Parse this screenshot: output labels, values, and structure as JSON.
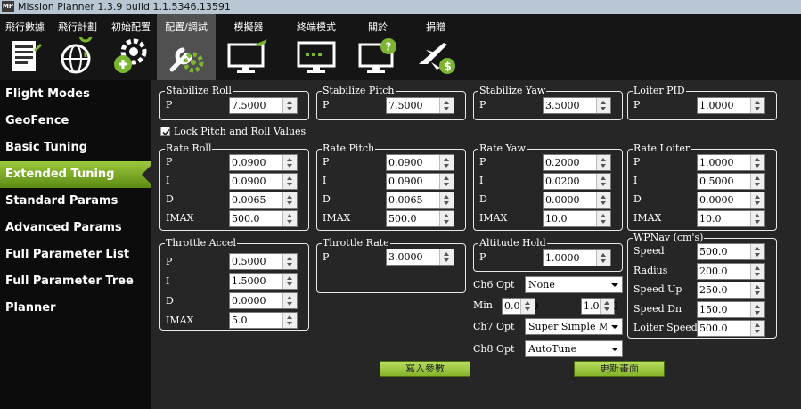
{
  "window": {
    "title": "Mission Planner 1.3.9 build 1.1.5346.13591",
    "icon_text": "MP"
  },
  "menu": [
    {
      "label": "飛行數據",
      "icon": "flight-data-icon"
    },
    {
      "label": "飛行計劃",
      "icon": "globe-icon"
    },
    {
      "label": "初始配置",
      "icon": "gear-plus-icon"
    },
    {
      "label": "配置/調試",
      "icon": "wrench-gear-icon"
    },
    {
      "label": "模擬器",
      "icon": "monitor-plane-icon"
    },
    {
      "label": "終端模式",
      "icon": "terminal-icon"
    },
    {
      "label": "關於",
      "icon": "help-monitor-icon"
    },
    {
      "label": "捐贈",
      "icon": "plane-donate-icon"
    }
  ],
  "sidebar": [
    "Flight Modes",
    "GeoFence",
    "Basic Tuning",
    "Extended Tuning",
    "Standard Params",
    "Advanced Params",
    "Full Parameter List",
    "Full Parameter Tree",
    "Planner"
  ],
  "stabilize_roll": {
    "title": "Stabilize Roll",
    "p_label": "P",
    "p": "7.5000"
  },
  "stabilize_pitch": {
    "title": "Stabilize Pitch",
    "p_label": "P",
    "p": "7.5000"
  },
  "stabilize_yaw": {
    "title": "Stabilize Yaw",
    "p_label": "P",
    "p": "3.5000"
  },
  "loiter_pid": {
    "title": "Loiter PID",
    "p_label": "P",
    "p": "1.0000"
  },
  "lock_pitch_roll": {
    "label": "Lock Pitch and Roll Values",
    "checked": true
  },
  "rate_roll": {
    "title": "Rate Roll",
    "rows": [
      {
        "label": "P",
        "value": "0.0900"
      },
      {
        "label": "I",
        "value": "0.0900"
      },
      {
        "label": "D",
        "value": "0.0065"
      },
      {
        "label": "IMAX",
        "value": "500.0"
      }
    ]
  },
  "rate_pitch": {
    "title": "Rate Pitch",
    "rows": [
      {
        "label": "P",
        "value": "0.0900"
      },
      {
        "label": "I",
        "value": "0.0900"
      },
      {
        "label": "D",
        "value": "0.0065"
      },
      {
        "label": "IMAX",
        "value": "500.0"
      }
    ]
  },
  "rate_yaw": {
    "title": "Rate Yaw",
    "rows": [
      {
        "label": "P",
        "value": "0.2000"
      },
      {
        "label": "I",
        "value": "0.0200"
      },
      {
        "label": "D",
        "value": "0.0000"
      },
      {
        "label": "IMAX",
        "value": "10.0"
      }
    ]
  },
  "rate_loiter": {
    "title": "Rate Loiter",
    "rows": [
      {
        "label": "P",
        "value": "1.0000"
      },
      {
        "label": "I",
        "value": "0.5000"
      },
      {
        "label": "D",
        "value": "0.0000"
      },
      {
        "label": "IMAX",
        "value": "10.0"
      }
    ]
  },
  "throttle_accel": {
    "title": "Throttle Accel",
    "rows": [
      {
        "label": "P",
        "value": "0.5000"
      },
      {
        "label": "I",
        "value": "1.5000"
      },
      {
        "label": "D",
        "value": "0.0000"
      },
      {
        "label": "IMAX",
        "value": "5.0"
      }
    ]
  },
  "throttle_rate": {
    "title": "Throttle Rate",
    "p_label": "P",
    "p": "3.0000"
  },
  "altitude_hold": {
    "title": "Altitude Hold",
    "p_label": "P",
    "p": "1.0000"
  },
  "wpnav": {
    "title": "WPNav (cm's)",
    "rows": [
      {
        "label": "Speed",
        "value": "500.0"
      },
      {
        "label": "Radius",
        "value": "200.0"
      },
      {
        "label": "Speed Up",
        "value": "250.0"
      },
      {
        "label": "Speed Dn",
        "value": "150.0"
      },
      {
        "label": "Loiter Speed",
        "value": "500.0"
      }
    ]
  },
  "ch6": {
    "label": "Ch6 Opt",
    "value": "None",
    "min_label": "Min",
    "min": "0.0000",
    "max": "1.0000"
  },
  "ch7": {
    "label": "Ch7 Opt",
    "value": "Super Simple Mode"
  },
  "ch8": {
    "label": "Ch8 Opt",
    "value": "AutoTune"
  },
  "buttons": {
    "write": "寫入參數",
    "refresh": "更新畫面"
  }
}
